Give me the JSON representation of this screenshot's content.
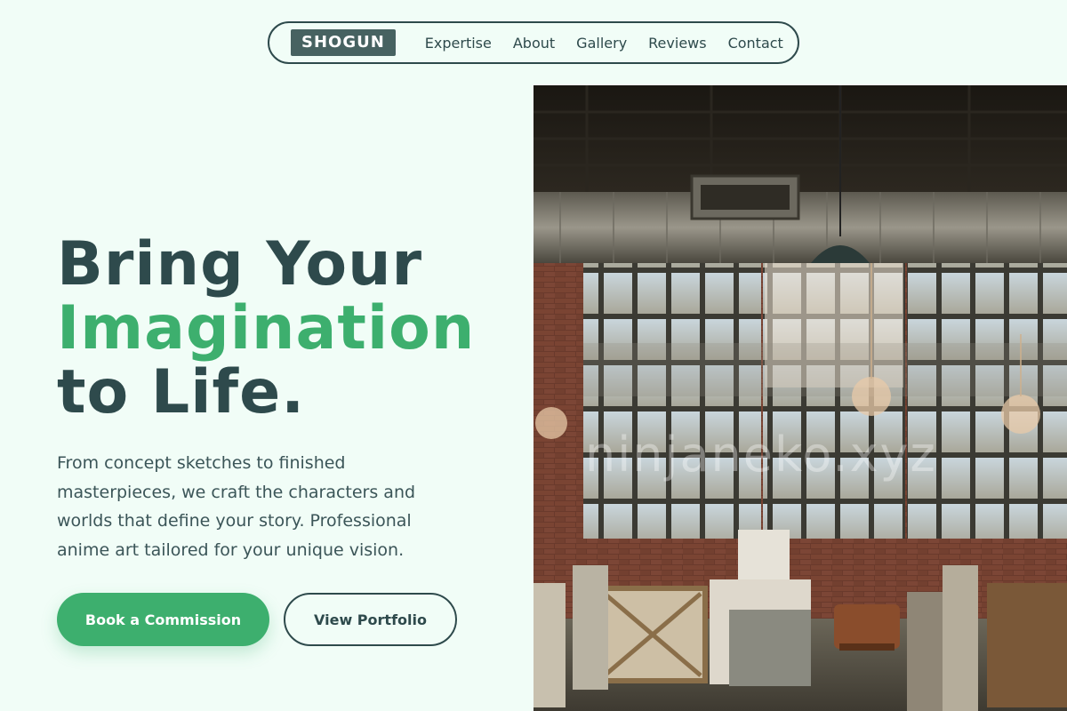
{
  "nav": {
    "logo": "SHOGUN",
    "links": [
      "Expertise",
      "About",
      "Gallery",
      "Reviews",
      "Contact"
    ]
  },
  "hero": {
    "headline_line1": "Bring Your",
    "headline_line2": "Imagination",
    "headline_line3": "to Life.",
    "description": "From concept sketches to finished masterpieces, we craft the characters and worlds that define your story. Professional anime art tailored for your unique vision.",
    "primary_cta": "Book a Commission",
    "secondary_cta": "View Portfolio"
  },
  "image": {
    "watermark": "ninjaneko.xyz",
    "subject": "industrial-art-studio-photo"
  },
  "colors": {
    "background": "#f1fdf7",
    "text_dark": "#2e4a4c",
    "accent_green": "#3daf6e",
    "logo_bg": "#476261"
  }
}
